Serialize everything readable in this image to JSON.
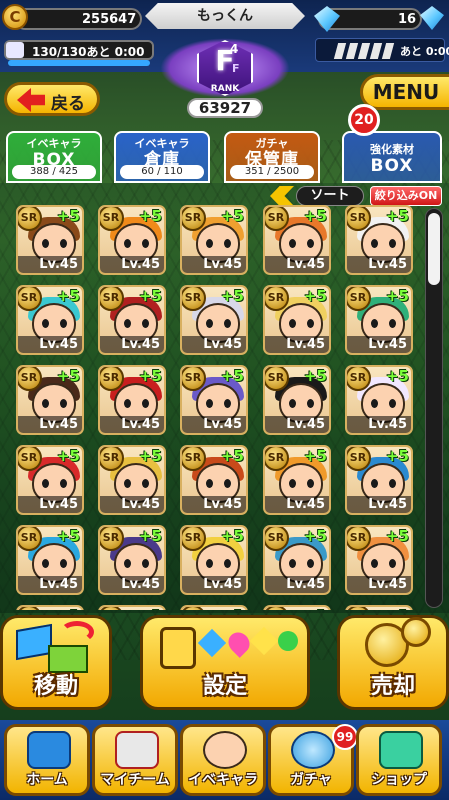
{
  "header": {
    "coins": "255647",
    "player_name": "もっくん",
    "gems": "16",
    "stamina": "130/130あと 0:00",
    "energy_timer": "あと 0:00"
  },
  "rank": {
    "letter": "F",
    "sup": "4",
    "sub": "F",
    "label": "RANK",
    "score": "63927"
  },
  "nav_top": {
    "back_label": "戻る",
    "menu_label": "MENU"
  },
  "tabs": [
    {
      "line1": "イベキャラ",
      "line2": "BOX",
      "count": "388 / 425",
      "color": "#2fae3a"
    },
    {
      "line1": "イベキャラ",
      "line2": "倉庫",
      "count": "60 / 110",
      "color": "#2a63c9"
    },
    {
      "line1": "ガチャ",
      "line2": "保管庫",
      "count": "351 / 2500",
      "color": "#c45a12"
    },
    {
      "line1": "強化素材",
      "line2": "BOX",
      "count": "",
      "color": "#2a5ab0"
    }
  ],
  "badge_materials": "20",
  "toolbar": {
    "sort_label": "ソート",
    "filter_label": "絞り込みON"
  },
  "cards": {
    "rarity": "SR",
    "plus": "+5",
    "level": "Lv.45"
  },
  "actions": {
    "move_label": "移動",
    "settings_label": "設定",
    "sell_label": "売却"
  },
  "bottom_nav": [
    {
      "label": "ホーム",
      "icon": "home-icon"
    },
    {
      "label": "マイチーム",
      "icon": "team-icon"
    },
    {
      "label": "イベキャラ",
      "icon": "event-chara-icon"
    },
    {
      "label": "ガチャ",
      "icon": "gacha-icon"
    },
    {
      "label": "ショップ",
      "icon": "shop-icon"
    }
  ],
  "gacha_badge": "99"
}
